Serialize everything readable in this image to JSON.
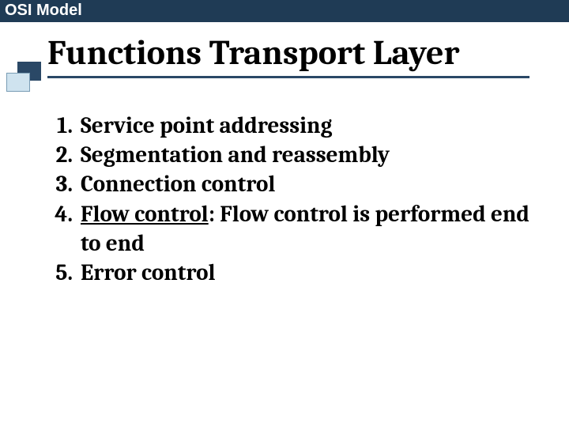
{
  "header": "OSI Model",
  "title": "Functions Transport Layer",
  "items": [
    {
      "text": "Service point addressing"
    },
    {
      "text": "Segmentation and reassembly"
    },
    {
      "text": "Connection control"
    },
    {
      "underlined": "Flow control",
      "rest": ": Flow control is performed end to end"
    },
    {
      "text": "Error control"
    }
  ],
  "colors": {
    "header_bg": "#1f3b55",
    "accent": "#2a4866",
    "icon_light": "#cfe3ef"
  }
}
